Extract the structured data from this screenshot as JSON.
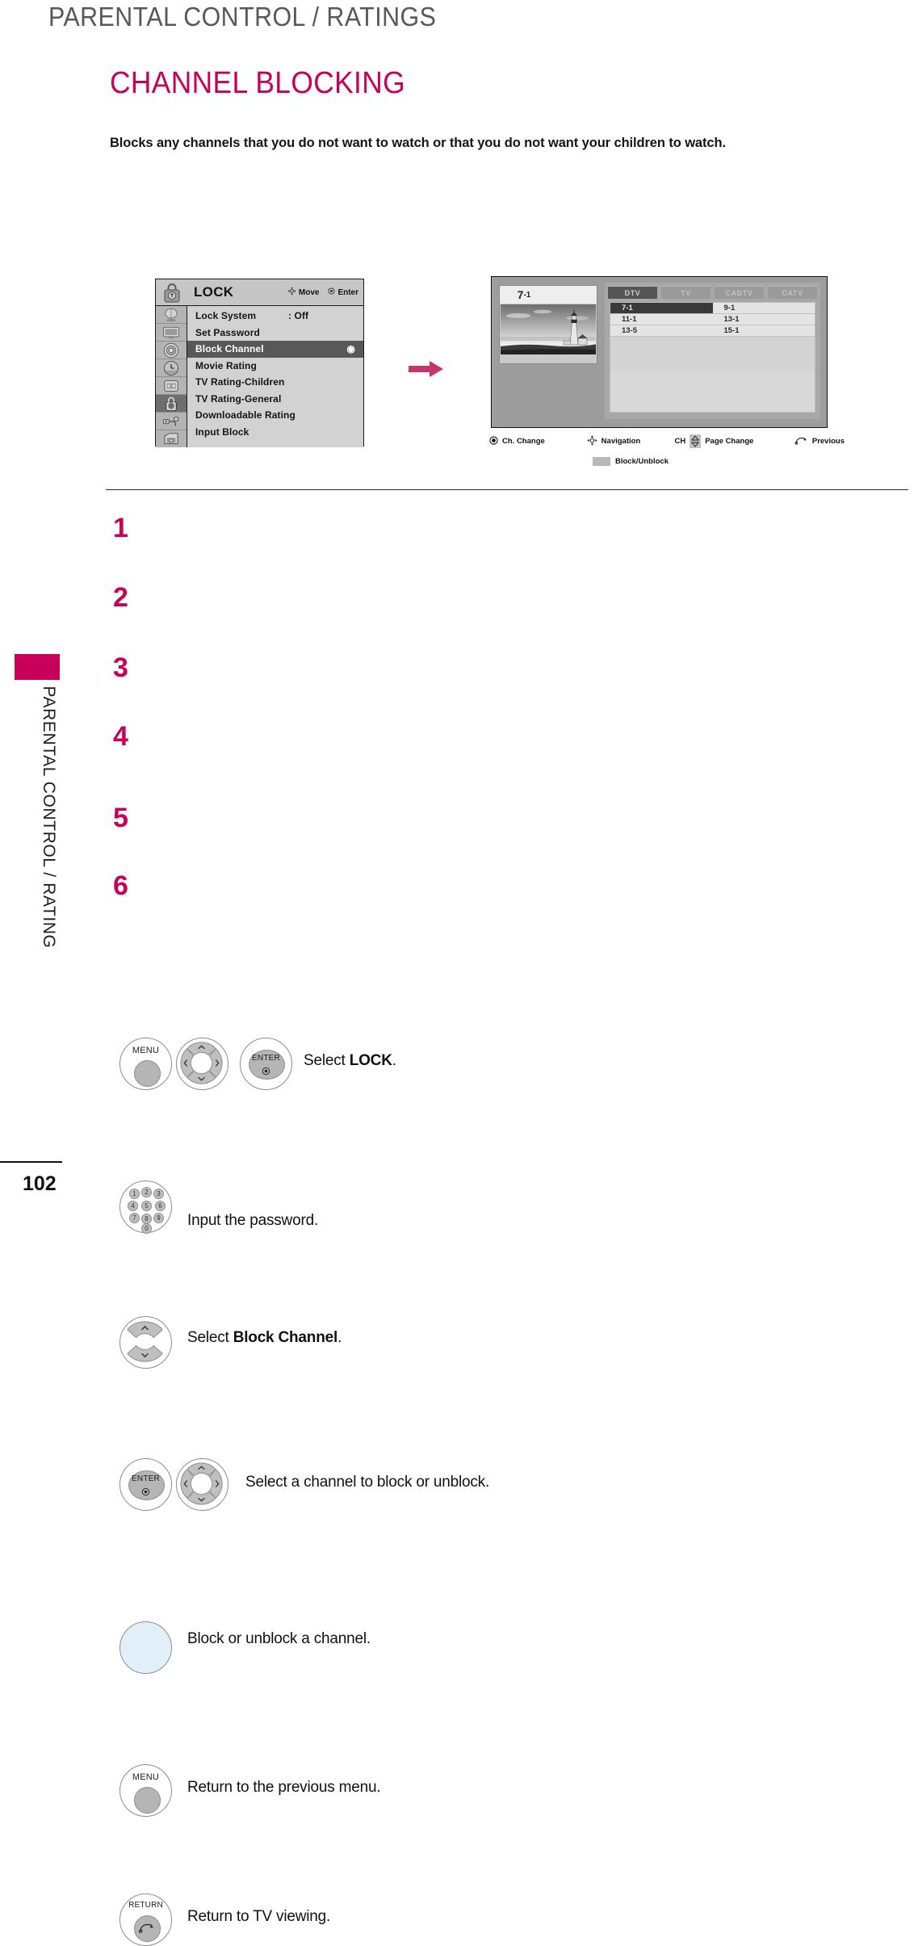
{
  "header": {
    "running_title": "PARENTAL CONTROL / RATINGS"
  },
  "section": {
    "title": "CHANNEL BLOCKING",
    "intro": "Blocks any channels that you do not want to watch or that you do not want your children to watch.",
    "accent_color": "#C8005A"
  },
  "osd": {
    "title": "LOCK",
    "hints": [
      {
        "icon": "dpad-icon",
        "label": "Move"
      },
      {
        "icon": "enter-dot-icon",
        "label": "Enter"
      }
    ],
    "icons": [
      "picture-icon",
      "display-icon",
      "audio-icon",
      "time-icon",
      "option-icon",
      "lock-icon",
      "input-icon",
      "usb-icon"
    ],
    "selected_icon_index": 5,
    "items": [
      {
        "label": "Lock System",
        "value": ": Off",
        "selected": false,
        "indicator": ""
      },
      {
        "label": "Set Password",
        "value": "",
        "selected": false,
        "indicator": ""
      },
      {
        "label": "Block Channel",
        "value": "",
        "selected": true,
        "indicator": "◉"
      },
      {
        "label": "Movie Rating",
        "value": "",
        "selected": false,
        "indicator": ""
      },
      {
        "label": "TV Rating-Children",
        "value": "",
        "selected": false,
        "indicator": ""
      },
      {
        "label": "TV Rating-General",
        "value": "",
        "selected": false,
        "indicator": ""
      },
      {
        "label": "Downloadable Rating",
        "value": "",
        "selected": false,
        "indicator": ""
      },
      {
        "label": "Input Block",
        "value": "",
        "selected": false,
        "indicator": ""
      }
    ]
  },
  "tv_screen": {
    "preview_channel_major": "7",
    "preview_channel_minor": "-1",
    "preview_image": "lighthouse-photo",
    "tabs": [
      {
        "label": "DTV",
        "active": true
      },
      {
        "label": "TV",
        "active": false
      },
      {
        "label": "CADTV",
        "active": false
      },
      {
        "label": "CATV",
        "active": false
      }
    ],
    "channels": [
      {
        "label": "7-1",
        "blocked": true
      },
      {
        "label": "9-1",
        "blocked": false
      },
      {
        "label": "11-1",
        "blocked": false
      },
      {
        "label": "13-1",
        "blocked": false
      },
      {
        "label": "13-5",
        "blocked": false
      },
      {
        "label": "15-1",
        "blocked": false
      }
    ],
    "legend": [
      {
        "icon": "enter-dot-icon",
        "label": "Ch. Change"
      },
      {
        "icon": "dpad-icon",
        "label": "Navigation"
      },
      {
        "icon": "ch-updown-icon",
        "label": "Page Change",
        "prefix": "CH"
      },
      {
        "icon": "return-icon",
        "label": "Previous"
      }
    ],
    "legend_swatch": {
      "icon": "gray-swatch",
      "label": "Block/Unblock"
    }
  },
  "steps": [
    {
      "number": "1",
      "text_before": "Select ",
      "text_bold": "LOCK",
      "text_after": ".",
      "buttons": [
        "MENU",
        "dpad-4way",
        "ENTER"
      ]
    },
    {
      "number": "2",
      "text_before": "Input the password.",
      "text_bold": "",
      "text_after": "",
      "buttons": [
        "number-pad"
      ]
    },
    {
      "number": "3",
      "text_before": "Select ",
      "text_bold": "Block Channel",
      "text_after": ".",
      "buttons": [
        "dpad-updown"
      ]
    },
    {
      "number": "4",
      "text_before": "Select a channel to block or unblock.",
      "text_bold": "",
      "text_after": "",
      "buttons": [
        "ENTER",
        "dpad-4way"
      ]
    },
    {
      "number": "5",
      "text_before": "Block or unblock a channel.",
      "text_bold": "",
      "text_after": "",
      "buttons": [
        "blue-blank"
      ]
    },
    {
      "number": "6",
      "text_before": "Return to the previous menu.",
      "text_bold": "",
      "text_after": "",
      "buttons": [
        "MENU"
      ]
    },
    {
      "number": "",
      "text_before": "Return to TV viewing.",
      "text_bold": "",
      "text_after": "",
      "buttons": [
        "RETURN"
      ]
    }
  ],
  "button_labels": {
    "menu": "MENU",
    "enter": "ENTER",
    "return": "RETURN"
  },
  "numpad_keys": [
    "1",
    "2",
    "3",
    "4",
    "5",
    "6",
    "7",
    "8",
    "9",
    "0"
  ],
  "side_tab_label": "PARENTAL CONTROL / RATING",
  "page_number": "102"
}
